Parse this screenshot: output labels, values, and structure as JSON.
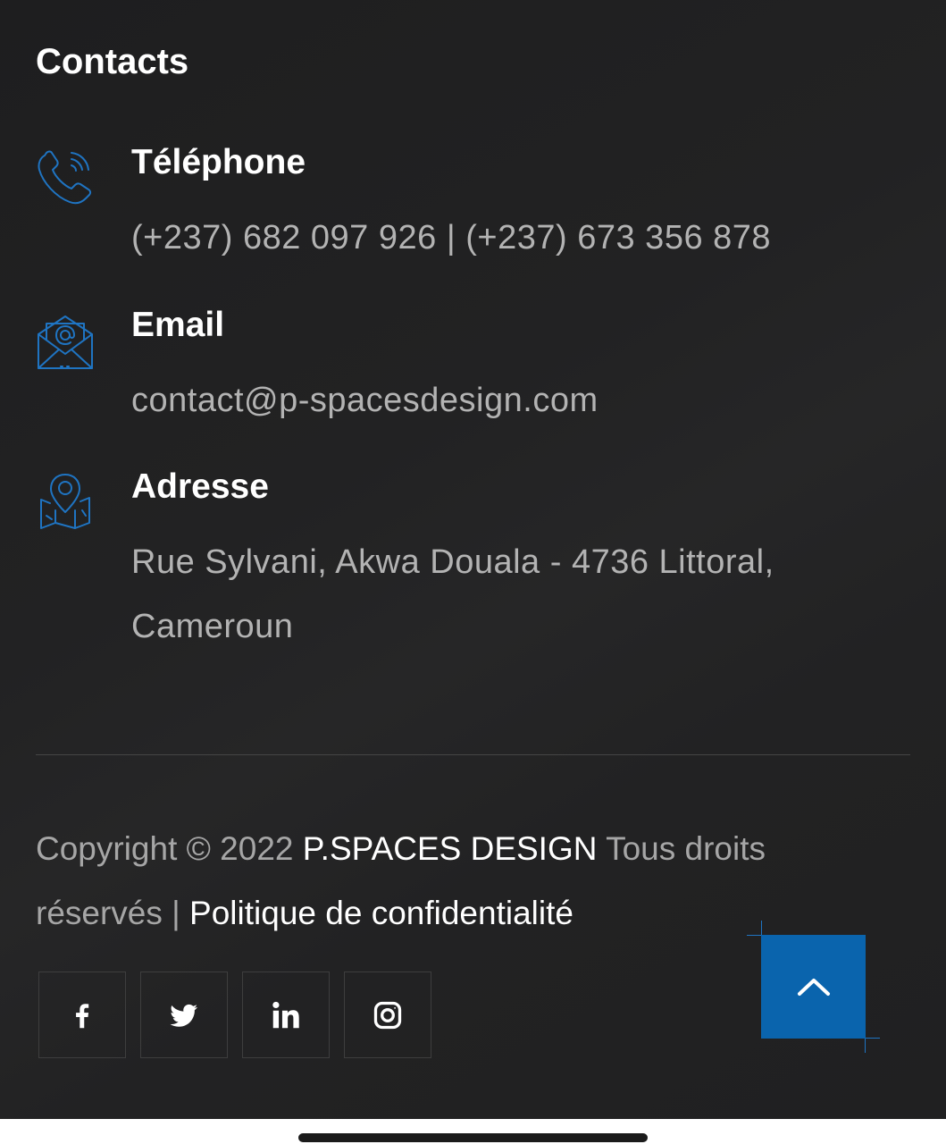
{
  "contacts": {
    "heading": "Contacts",
    "phone": {
      "icon": "phone-icon",
      "title": "Téléphone",
      "value": "(+237) 682 097 926 | (+237) 673 356 878"
    },
    "email": {
      "icon": "envelope-icon",
      "title": "Email",
      "value": "contact@p-spacesdesign.com"
    },
    "address": {
      "icon": "map-pin-icon",
      "title": "Adresse",
      "value": "Rue Sylvani, Akwa Douala - 4736 Littoral, Cameroun"
    }
  },
  "footer": {
    "copyright_prefix": "Copyright © 2022 ",
    "company_link": "P.SPACES DESIGN",
    "rights_text": " Tous droits réservés | ",
    "privacy_link": "Politique de confidentialité"
  },
  "social": [
    {
      "name": "facebook",
      "icon": "facebook-icon"
    },
    {
      "name": "twitter",
      "icon": "twitter-icon"
    },
    {
      "name": "linkedin",
      "icon": "linkedin-icon"
    },
    {
      "name": "instagram",
      "icon": "instagram-icon"
    }
  ],
  "back_to_top": {
    "icon": "chevron-up-icon"
  },
  "colors": {
    "background": "#222223",
    "accent": "#0a64ad",
    "icon_blue": "#1f74c2",
    "heading_text": "#ffffff",
    "body_text": "#b3b3b3"
  }
}
